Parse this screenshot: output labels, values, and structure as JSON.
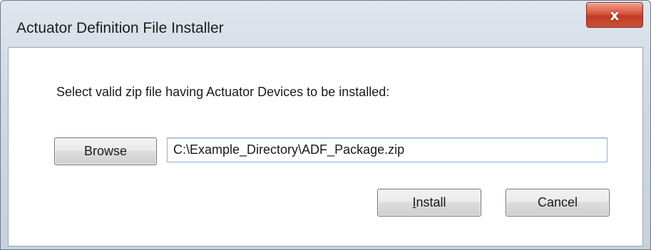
{
  "window": {
    "title": "Actuator Definition File Installer",
    "close_icon": "close-x-icon",
    "close_glyph": "x"
  },
  "content": {
    "prompt": "Select valid zip file having Actuator Devices to be installed:",
    "browse_label": "Browse",
    "path_value": "C:\\Example_Directory\\ADF_Package.zip",
    "install_mnemonic": "I",
    "install_rest": "nstall",
    "cancel_label": "Cancel"
  },
  "colors": {
    "close_button": "#c8503a",
    "window_frame": "#cfd8e3",
    "input_border": "#8fb3d9"
  }
}
